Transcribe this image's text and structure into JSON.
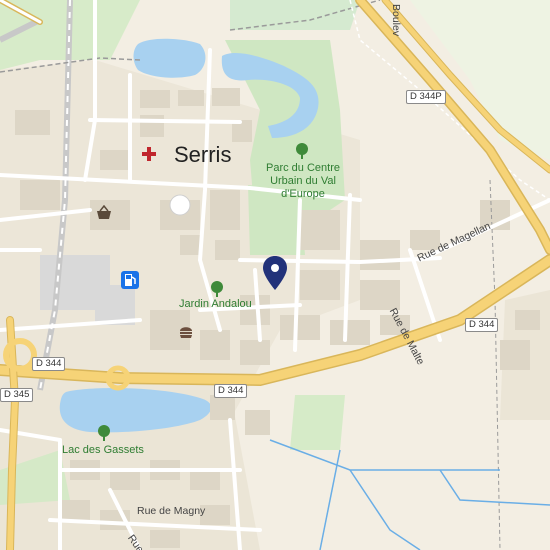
{
  "map": {
    "colors": {
      "land": "#f3eee3",
      "urban": "#ece6d8",
      "building": "#ddd6c6",
      "park": "#cfe7c2",
      "water": "#a8d1f0",
      "road_major": "#f6d377",
      "road_minor": "#ffffff",
      "rail": "#c8c8c8",
      "marker": "#22327a",
      "hospital_red": "#c0262d",
      "fuel_blue": "#1a73e8"
    },
    "labels": {
      "town": "Serris",
      "parc": [
        "Parc du Centre",
        "Urbain du Val",
        "d'Europe"
      ],
      "jardin": "Jardin Andalou",
      "lac": "Lac des Gassets",
      "rue_magellan": "Rue de Magellan",
      "rue_malte": "Rue de Malte",
      "rue_magny": "Rue de Magny",
      "rue_magny_cut": "Rue d",
      "boulevard": "Boulev"
    },
    "roads": {
      "d344p": "D 344P",
      "d344_east": "D 344",
      "d344_center": "D 344",
      "d344_west": "D 344",
      "d345": "D 345"
    },
    "icons": [
      "hospital-icon",
      "shopping-basket-icon",
      "fuel-icon",
      "restaurant-icon",
      "park-tree-icon",
      "location-pin-icon"
    ]
  }
}
